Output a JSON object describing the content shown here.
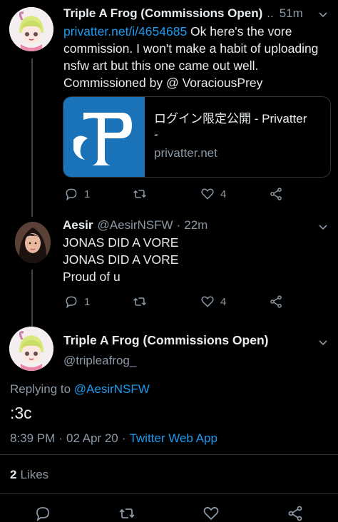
{
  "tweet1": {
    "name": "Triple A Frog (Commissions Open)",
    "sep": "..",
    "time": "51m",
    "link": "privatter.net/i/4654685",
    "text": " Ok here's the vore commission. I won't make a habit of uploading nsfw art but this one came out well. Commissioned by @ VoraciousPrey",
    "card": {
      "title": "ログイン限定公開 - Privatter",
      "subtitle": "-",
      "domain": "privatter.net",
      "logo_letter": "P"
    },
    "replies": "1",
    "likes": "4"
  },
  "tweet2": {
    "name": "Aesir",
    "handle": "@AesirNSFW",
    "sep": "·",
    "time": "22m",
    "lines": [
      "JONAS DID A VORE",
      "JONAS DID A VORE",
      "Proud of u"
    ],
    "replies": "1",
    "likes": "4"
  },
  "main": {
    "name": "Triple A Frog (Commissions Open)",
    "handle": "@tripleafrog_",
    "replying_prefix": "Replying to ",
    "replying_to": "@AesirNSFW",
    "text": ":3c",
    "time": "8:39 PM",
    "sep1": "·",
    "date": "02 Apr 20",
    "sep2": "·",
    "source": "Twitter Web App",
    "likes_count": "2",
    "likes_label": "Likes"
  },
  "colors": {
    "background": "#000000",
    "accent": "#1d9bf0",
    "muted": "#8b98a5",
    "card_logo_bg": "#1a72b8"
  },
  "icons": [
    "reply-icon",
    "retweet-icon",
    "like-icon",
    "share-icon",
    "chevron-down-icon"
  ]
}
